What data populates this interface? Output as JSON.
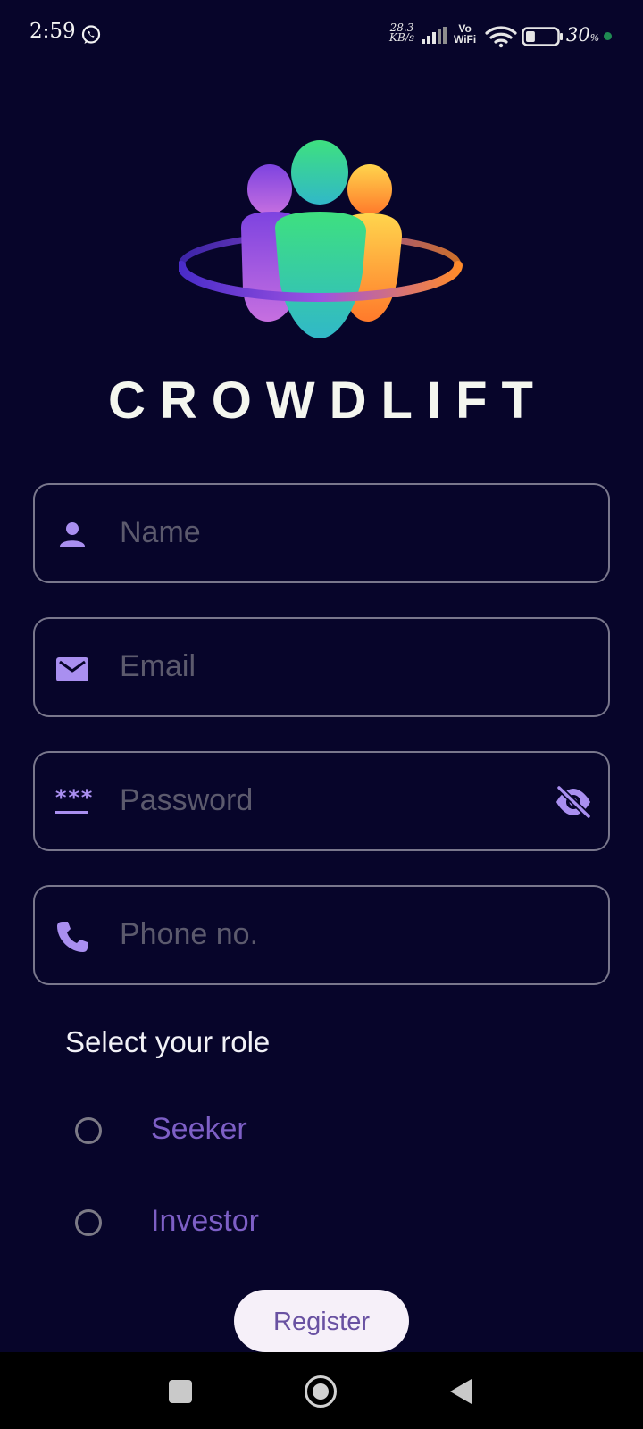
{
  "status_bar": {
    "time": "2:59",
    "net_speed_value": "28.3",
    "net_speed_unit": "KB/s",
    "vo_label": "Vo",
    "wifi_label": "WiFi",
    "battery_percent": "30",
    "battery_unit": "%",
    "battery_level": 0.3
  },
  "app": {
    "brand_name": "CROWDLIFT"
  },
  "form": {
    "name_placeholder": "Name",
    "email_placeholder": "Email",
    "password_placeholder": "Password",
    "password_icon_text": "***",
    "phone_placeholder": "Phone no."
  },
  "role": {
    "title": "Select your role",
    "options": [
      {
        "label": "Seeker",
        "selected": false
      },
      {
        "label": "Investor",
        "selected": false
      }
    ]
  },
  "actions": {
    "register_label": "Register"
  },
  "colors": {
    "background": "#07052a",
    "field_border": "#79778c",
    "icon_purple": "#a98ff0",
    "radio_label": "#7d5fc6",
    "button_bg": "#f6f0f9",
    "button_text": "#6951a2"
  },
  "icons": {
    "notification": "whatsapp-icon",
    "name_field": "person-icon",
    "email_field": "mail-icon",
    "password_field": "password-dots-icon",
    "password_toggle": "eye-off-icon",
    "phone_field": "phone-icon"
  }
}
